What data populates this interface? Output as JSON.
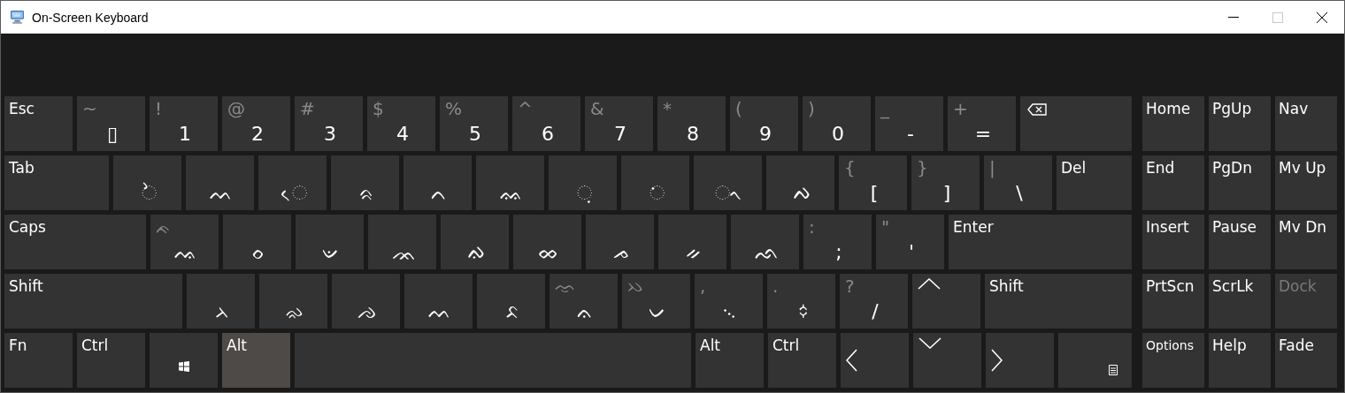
{
  "window": {
    "title": "On-Screen Keyboard"
  },
  "rows": [
    [
      {
        "kind": "label",
        "label": "Esc",
        "pressed": false
      },
      {
        "kind": "char",
        "shift": "~",
        "base": "▯"
      },
      {
        "kind": "char",
        "shift": "!",
        "base": "1"
      },
      {
        "kind": "char",
        "shift": "@",
        "base": "2"
      },
      {
        "kind": "char",
        "shift": "#",
        "base": "3"
      },
      {
        "kind": "char",
        "shift": "$",
        "base": "4"
      },
      {
        "kind": "char",
        "shift": "%",
        "base": "5"
      },
      {
        "kind": "char",
        "shift": "^",
        "base": "6"
      },
      {
        "kind": "char",
        "shift": "&",
        "base": "7"
      },
      {
        "kind": "char",
        "shift": "*",
        "base": "8"
      },
      {
        "kind": "char",
        "shift": "(",
        "base": "9"
      },
      {
        "kind": "char",
        "shift": ")",
        "base": "0"
      },
      {
        "kind": "char",
        "shift": "_",
        "base": "-"
      },
      {
        "kind": "char",
        "shift": "+",
        "base": "="
      },
      {
        "kind": "backspace"
      }
    ],
    [
      {
        "kind": "label",
        "label": "Tab",
        "pressed": false
      },
      {
        "kind": "char",
        "base": "◌ᨛ"
      },
      {
        "kind": "char",
        "base": "ᨓ"
      },
      {
        "kind": "char",
        "base": "◌ᨙ"
      },
      {
        "kind": "char",
        "base": "ᨑ"
      },
      {
        "kind": "char",
        "base": "ᨈ"
      },
      {
        "kind": "char",
        "base": "ᨐ"
      },
      {
        "kind": "char",
        "base": "◌ᨘ"
      },
      {
        "kind": "char",
        "base": "◌ᨗ"
      },
      {
        "kind": "char",
        "base": "◌ᨚ"
      },
      {
        "kind": "char",
        "base": "ᨄ"
      },
      {
        "kind": "char",
        "shift": "{",
        "base": "["
      },
      {
        "kind": "char",
        "shift": "}",
        "base": "]"
      },
      {
        "kind": "char",
        "shift": "|",
        "base": "\\"
      },
      {
        "kind": "label",
        "label": "Del",
        "pressed": false
      }
    ],
    [
      {
        "kind": "label",
        "label": "Caps",
        "pressed": false
      },
      {
        "kind": "char",
        "shift": "ᨃ",
        "base": "ᨕ"
      },
      {
        "kind": "char",
        "base": "ᨔ"
      },
      {
        "kind": "char",
        "base": "ᨉ"
      },
      {
        "kind": "char",
        "base": "ᨏ"
      },
      {
        "kind": "char",
        "base": "ᨁ"
      },
      {
        "kind": "char",
        "base": "ᨖ"
      },
      {
        "kind": "char",
        "base": "ᨍ"
      },
      {
        "kind": "char",
        "base": "ᨀ"
      },
      {
        "kind": "char",
        "base": "ᨒ"
      },
      {
        "kind": "char",
        "shift": ":",
        "base": ";"
      },
      {
        "kind": "char",
        "shift": "\"",
        "base": "'"
      },
      {
        "kind": "label",
        "label": "Enter",
        "pressed": false
      }
    ],
    [
      {
        "kind": "label",
        "label": "Shift",
        "pressed": false
      },
      {
        "kind": "char",
        "base": "ᨂ"
      },
      {
        "kind": "char",
        "base": "ᨋ"
      },
      {
        "kind": "char",
        "base": "ᨌ"
      },
      {
        "kind": "char",
        "base": "ᨓ"
      },
      {
        "kind": "char",
        "base": "ᨅ"
      },
      {
        "kind": "char",
        "shift": "ᨎ",
        "base": "ᨊ"
      },
      {
        "kind": "char",
        "shift": "ᨇ",
        "base": "ᨆ"
      },
      {
        "kind": "char",
        "shift": ",",
        "base": "᨞"
      },
      {
        "kind": "char",
        "shift": ".",
        "base": "᨟"
      },
      {
        "kind": "char",
        "shift": "?",
        "base": "/"
      },
      {
        "kind": "arrow-up"
      },
      {
        "kind": "label",
        "label": "Shift",
        "pressed": false
      }
    ],
    [
      {
        "kind": "label",
        "label": "Fn",
        "pressed": false
      },
      {
        "kind": "label",
        "label": "Ctrl",
        "pressed": false
      },
      {
        "kind": "windows"
      },
      {
        "kind": "label",
        "label": "Alt",
        "pressed": true
      },
      {
        "kind": "space"
      },
      {
        "kind": "label",
        "label": "Alt",
        "pressed": false
      },
      {
        "kind": "label",
        "label": "Ctrl",
        "pressed": false
      },
      {
        "kind": "arrow-left"
      },
      {
        "kind": "arrow-down"
      },
      {
        "kind": "arrow-right"
      },
      {
        "kind": "menu"
      }
    ]
  ],
  "side_keys": [
    [
      {
        "label": "Home",
        "disabled": false
      },
      {
        "label": "PgUp",
        "disabled": false
      },
      {
        "label": "Nav",
        "disabled": false
      }
    ],
    [
      {
        "label": "End",
        "disabled": false
      },
      {
        "label": "PgDn",
        "disabled": false
      },
      {
        "label": "Mv Up",
        "disabled": false
      }
    ],
    [
      {
        "label": "Insert",
        "disabled": false
      },
      {
        "label": "Pause",
        "disabled": false
      },
      {
        "label": "Mv Dn",
        "disabled": false
      }
    ],
    [
      {
        "label": "PrtScn",
        "disabled": false
      },
      {
        "label": "ScrLk",
        "disabled": false
      },
      {
        "label": "Dock",
        "disabled": true
      }
    ],
    [
      {
        "label": "Options",
        "disabled": false
      },
      {
        "label": "Help",
        "disabled": false
      },
      {
        "label": "Fade",
        "disabled": false
      }
    ]
  ]
}
